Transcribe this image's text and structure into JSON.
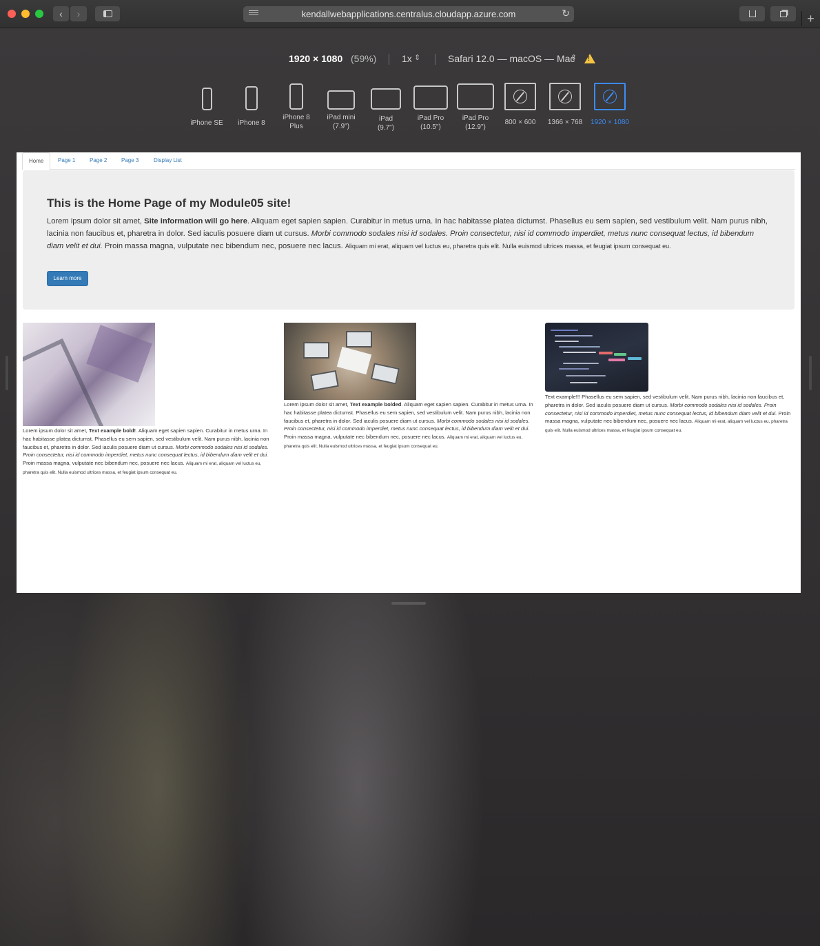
{
  "browser": {
    "url": "kendallwebapplications.centralus.cloudapp.azure.com",
    "back_icon": "chevron-left-icon",
    "forward_icon": "chevron-right-icon"
  },
  "responsive": {
    "resolution": "1920 × 1080",
    "scale_percent": "(59%)",
    "pixel_ratio": "1x",
    "user_agent": "Safari 12.0 — macOS — Mac",
    "devices": [
      {
        "label": "iPhone SE",
        "label2": ""
      },
      {
        "label": "iPhone 8",
        "label2": ""
      },
      {
        "label": "iPhone 8",
        "label2": "Plus"
      },
      {
        "label": "iPad mini",
        "label2": "(7.9\")"
      },
      {
        "label": "iPad",
        "label2": "(9.7\")"
      },
      {
        "label": "iPad Pro",
        "label2": "(10.5\")"
      },
      {
        "label": "iPad Pro",
        "label2": "(12.9\")"
      },
      {
        "label": "800 × 600",
        "label2": ""
      },
      {
        "label": "1366 × 768",
        "label2": ""
      },
      {
        "label": "1920 × 1080",
        "label2": ""
      }
    ],
    "selected_color": "#3d8cf5"
  },
  "site": {
    "tabs": [
      "Home",
      "Page 1",
      "Page 2",
      "Page 3",
      "Display List"
    ],
    "jumbotron": {
      "title": "This is the Home Page of my Module05 site!",
      "p1": "Lorem ipsum dolor sit amet, ",
      "p_bold": "Site information will go here",
      "p2": ". Aliquam eget sapien sapien. Curabitur in metus urna. In hac habitasse platea dictumst. Phasellus eu sem sapien, sed vestibulum velit. Nam purus nibh, lacinia non faucibus et, pharetra in dolor. Sed iaculis posuere diam ut cursus. ",
      "p_italic": "Morbi commodo sodales nisi id sodales. Proin consectetur, nisi id commodo imperdiet, metus nunc consequat lectus, id bibendum diam velit et dui.",
      "p3": " Proin massa magna, vulputate nec bibendum nec, posuere nec lacus. ",
      "p_small": "Aliquam mi erat, aliquam vel luctus eu, pharetra quis elit. Nulla euismod ultrices massa, et feugiat ipsum consequat eu.",
      "button": "Learn more"
    },
    "columns": [
      {
        "a": "Lorem ipsum dolor sit amet, ",
        "bold": "Text example bold!",
        "b": ". Aliquam eget sapien sapien. Curabitur in metus urna. In hac habitasse platea dictumst. Phasellus eu sem sapien, sed vestibulum velit. Nam purus nibh, lacinia non faucibus et, pharetra in dolor. Sed iaculis posuere diam ut cursus. ",
        "italic": "Morbi commodo sodales nisi id sodales. Proin consectetur, nisi id commodo imperdiet, metus nunc consequat lectus, id bibendum diam velit et dui.",
        "c": " Proin massa magna, vulputate nec bibendum nec, posuere nec lacus. ",
        "small": "Aliquam mi erat, aliquam vel luctus eu, pharetra quis elit. Nulla euismod ultrices massa, et feugiat ipsum consequat eu."
      },
      {
        "a": "Lorem ipsum dolor sit amet, ",
        "bold": "Text example bolded",
        "b": ". Aliquam eget sapien sapien. Curabitur in metus urna. In hac habitasse platea dictumst. Phasellus eu sem sapien, sed vestibulum velit. Nam purus nibh, lacinia non faucibus et, pharetra in dolor. Sed iaculis posuere diam ut cursus. ",
        "italic": "Morbi commodo sodales nisi id sodales. Proin consectetur, nisi id commodo imperdiet, metus nunc consequat lectus, id bibendum diam velit et dui.",
        "c": " Proin massa magna, vulputate nec bibendum nec, posuere nec lacus. ",
        "small": "Aliquam mi erat, aliquam vel luctus eu, pharetra quis elit. Nulla euismod ultrices massa, et feugiat ipsum consequat eu."
      },
      {
        "a": "Text example!!! Phasellus eu sem sapien, sed vestibulum velit. Nam purus nibh, lacinia non faucibus et, pharetra in dolor. Sed iaculis posuere diam ut cursus. ",
        "bold": "",
        "b": "",
        "italic": "Morbi commodo sodales nisi id sodales. Proin consectetur, nisi id commodo imperdiet, metus nunc consequat lectus, id bibendum diam velit et dui.",
        "c": " Proin massa magna, vulputate nec bibendum nec, posuere nec lacus. ",
        "small": "Aliquam mi erat, aliquam vel luctus eu, pharetra quis elit. Nulla euismod ultrices massa, et feugiat ipsum consequat eu."
      }
    ]
  }
}
